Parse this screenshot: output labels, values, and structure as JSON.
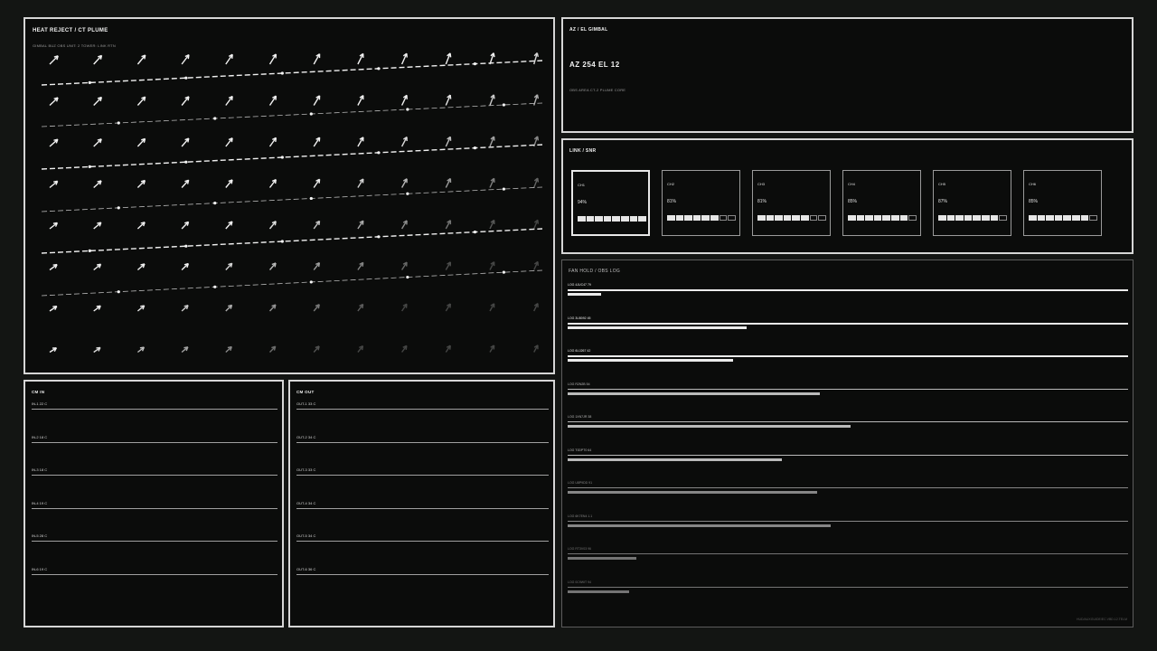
{
  "plume": {
    "title": "HEAT REJECT / CT PLUME",
    "subtitle": "GIMBAL BUZ OBS UNIT: 2 TOWER: LINK RTN"
  },
  "gimbal": {
    "title": "AZ / EL GIMBAL",
    "reading": "AZ 254  EL 12",
    "detail": "OBS AREA  CT-2  PLUME CORE"
  },
  "link": {
    "title": "LINK / SNR",
    "channels": [
      {
        "label": "CH1",
        "value": "94%",
        "level": 1.0,
        "active": true
      },
      {
        "label": "CH2",
        "value": "81%",
        "level": 0.75,
        "active": false
      },
      {
        "label": "CH3",
        "value": "81%",
        "level": 0.75,
        "active": false
      },
      {
        "label": "CH4",
        "value": "85%",
        "level": 0.875,
        "active": false
      },
      {
        "label": "CH5",
        "value": "87%",
        "level": 0.875,
        "active": false
      },
      {
        "label": "CH6",
        "value": "85%",
        "level": 0.875,
        "active": false
      }
    ]
  },
  "fan": {
    "title": "FAN HOLD / OBS LOG",
    "footer": "HUD/AUXGUIDE/EC.VBD.12.TELM",
    "logs": [
      {
        "label": "LOG 4JUC47 79",
        "bar": 0.06,
        "intensity": 1.0
      },
      {
        "label": "LOG 3U8092 45",
        "bar": 0.32,
        "intensity": 1.0
      },
      {
        "label": "LOG 6UJ267 42",
        "bar": 0.295,
        "intensity": 1.0
      },
      {
        "label": "LOG R2N2B 54",
        "bar": 0.45,
        "intensity": 0.72
      },
      {
        "label": "LOG 1XN7JR 38",
        "bar": 0.505,
        "intensity": 0.72
      },
      {
        "label": "LOG T0DPT0 64",
        "bar": 0.382,
        "intensity": 0.72
      },
      {
        "label": "LOG U8P9DD 91",
        "bar": 0.445,
        "intensity": 0.42
      },
      {
        "label": "LOG 6K7EN4 1.1",
        "bar": 0.47,
        "intensity": 0.42
      },
      {
        "label": "LOG RT3V03 96",
        "bar": 0.122,
        "intensity": 0.32
      },
      {
        "label": "LOG 0C9WIT 94",
        "bar": 0.11,
        "intensity": 0.32
      }
    ]
  },
  "cm_in": {
    "title": "CM IN",
    "rows": [
      {
        "label": "IN-1  22 C"
      },
      {
        "label": "IN-2  18 C"
      },
      {
        "label": "IN-3  18 C"
      },
      {
        "label": "IN-4  19 C"
      },
      {
        "label": "IN-5  28 C"
      },
      {
        "label": "IN-6  19 C"
      }
    ]
  },
  "cm_out": {
    "title": "CM OUT",
    "rows": [
      {
        "label": "OUT-1  33 C"
      },
      {
        "label": "OUT-2  34 C"
      },
      {
        "label": "OUT-3  33 C"
      },
      {
        "label": "OUT-4  34 C"
      },
      {
        "label": "OUT-5  34 C"
      },
      {
        "label": "OUT-6  36 C"
      }
    ]
  }
}
